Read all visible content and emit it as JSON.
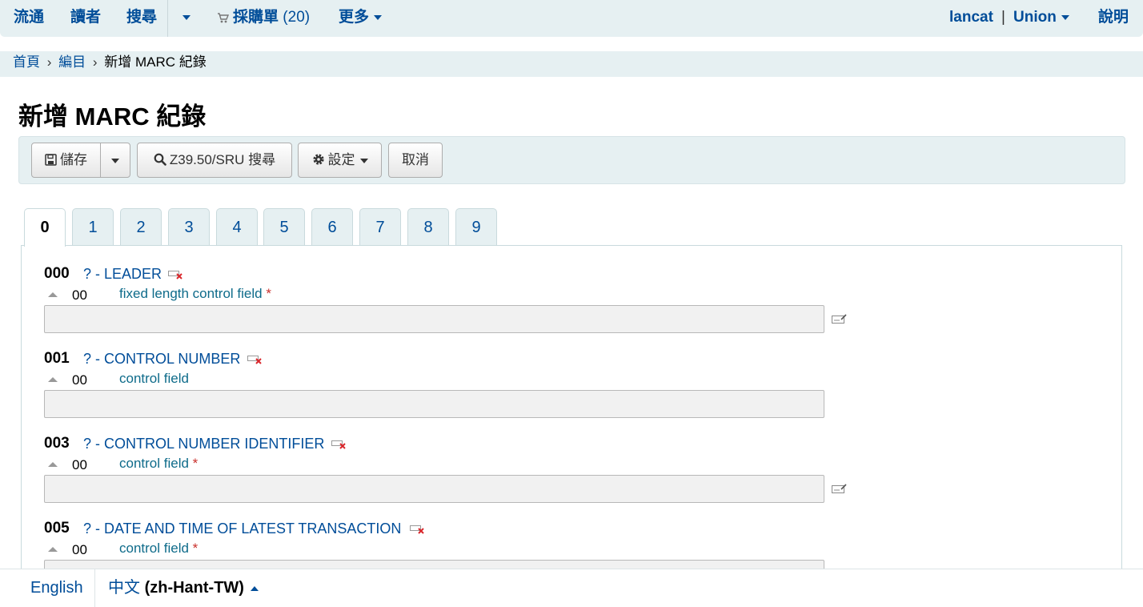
{
  "navbar": {
    "circulation": "流通",
    "patrons": "讀者",
    "search": "搜尋",
    "cart_label": "採購單",
    "cart_count": "(20)",
    "more": "更多",
    "user": "lancat",
    "user_sep": "|",
    "library": "Union",
    "help": "說明"
  },
  "breadcrumb": {
    "home": "首頁",
    "cataloging": "編目",
    "current": "新增 MARC 紀錄",
    "sep": "›"
  },
  "page_title": "新增 MARC 紀錄",
  "toolbar": {
    "save": "儲存",
    "z3950": "Z39.50/SRU 搜尋",
    "settings": "設定",
    "cancel": "取消"
  },
  "tabs": [
    "0",
    "1",
    "2",
    "3",
    "4",
    "5",
    "6",
    "7",
    "8",
    "9"
  ],
  "active_tab": "0",
  "fields": [
    {
      "tag": "000",
      "help": "? -",
      "name": "LEADER",
      "subfield": "00",
      "description": "fixed length control field",
      "required": "*",
      "value": "",
      "has_plugin": true
    },
    {
      "tag": "001",
      "help": "? -",
      "name": "CONTROL NUMBER",
      "subfield": "00",
      "description": "control field",
      "required": "",
      "value": "",
      "has_plugin": false
    },
    {
      "tag": "003",
      "help": "? -",
      "name": "CONTROL NUMBER IDENTIFIER",
      "subfield": "00",
      "description": "control field",
      "required": "*",
      "value": "",
      "has_plugin": true
    },
    {
      "tag": "005",
      "help": "? -",
      "name": "DATE AND TIME OF LATEST TRANSACTION",
      "subfield": "00",
      "description": "control field",
      "required": "*",
      "value": "",
      "has_plugin": false
    }
  ],
  "footer": {
    "english": "English",
    "current_lang": "中文",
    "current_code": "(zh-Hant-TW)"
  },
  "colors": {
    "link": "#004d99",
    "bar_background": "#e6f0f2",
    "required": "#c9302c"
  },
  "icons": {
    "save": "floppy-disk-icon",
    "search": "magnifier-icon",
    "settings": "gear-icon",
    "cart": "cart-icon",
    "delete_tag": "delete-tag-icon",
    "plugin": "edit-plugin-icon",
    "move_up": "arrow-up-icon"
  }
}
